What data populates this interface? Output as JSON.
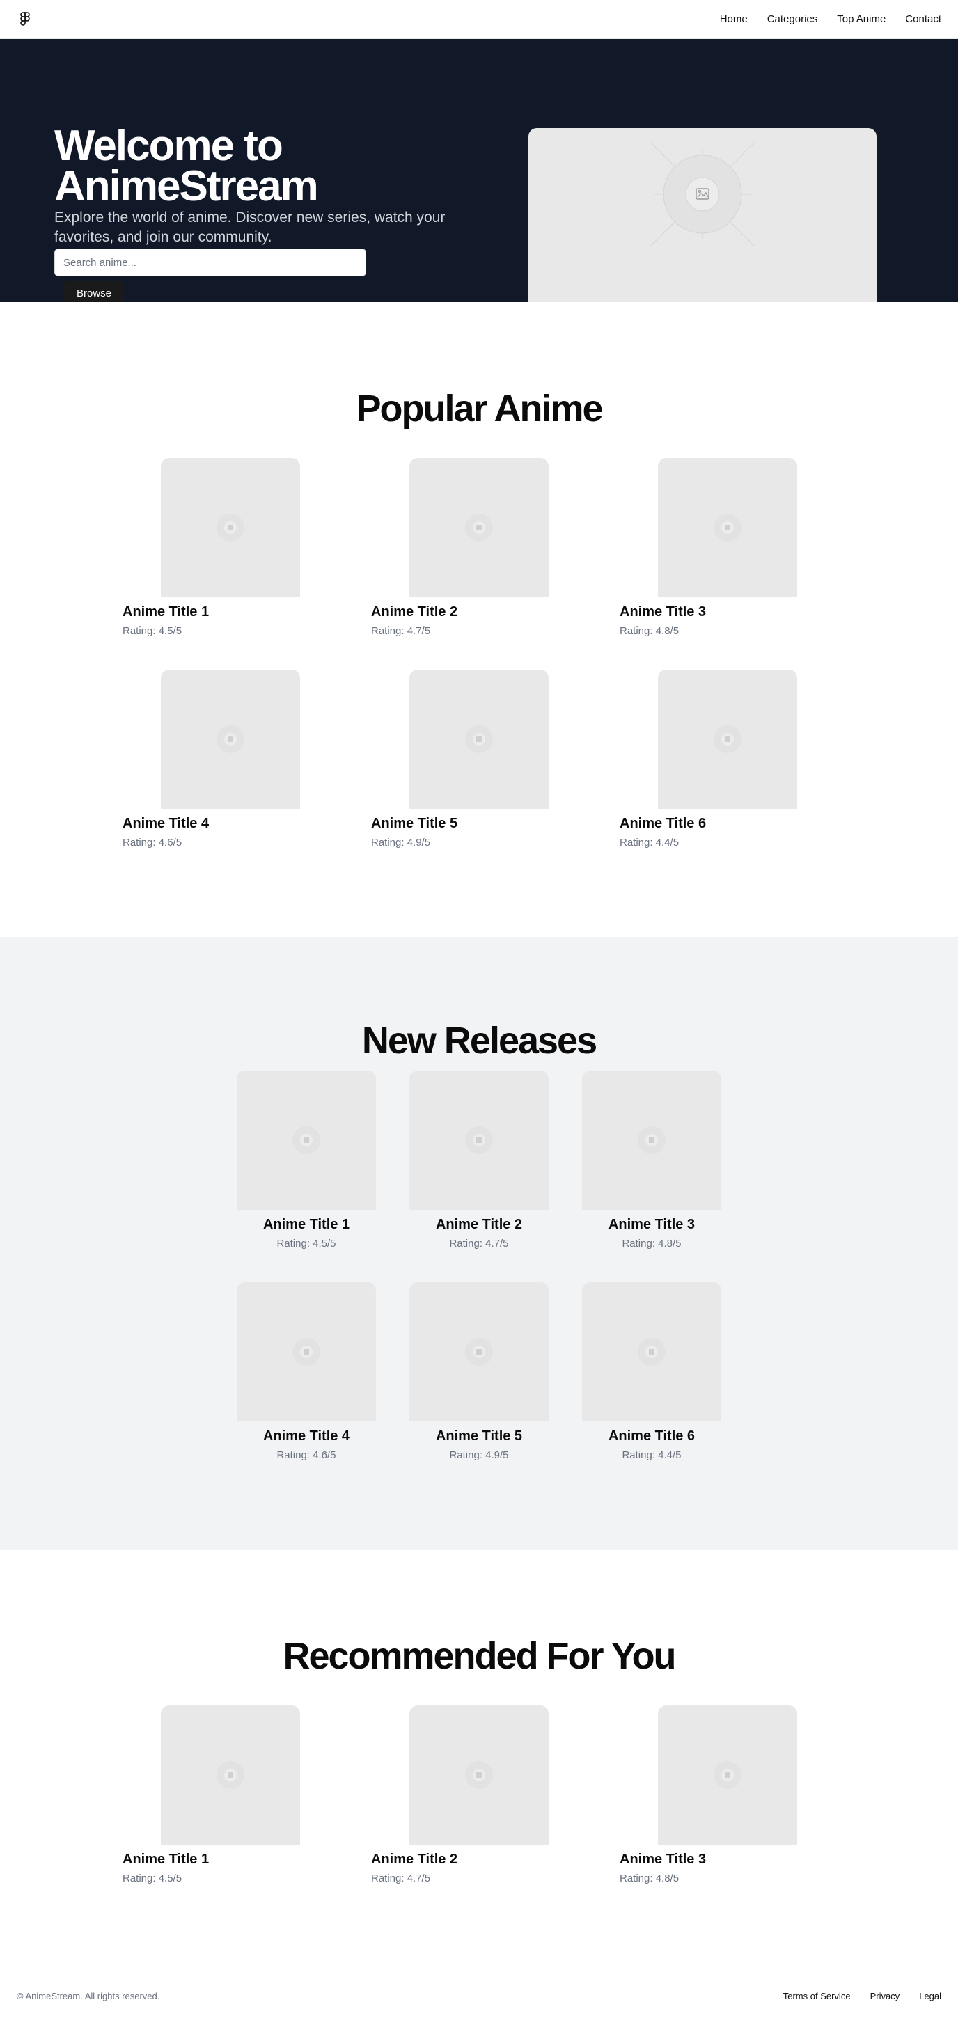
{
  "nav": {
    "logo_icon": "figma-logo-icon",
    "links": [
      {
        "label": "Home"
      },
      {
        "label": "Categories"
      },
      {
        "label": "Top Anime"
      },
      {
        "label": "Contact"
      }
    ]
  },
  "hero": {
    "title_line1": "Welcome to",
    "title_line2": "AnimeStream",
    "subtitle": "Explore the world of anime. Discover new series, watch your favorites, and join our community.",
    "search_placeholder": "Search anime...",
    "button_label": "Browse",
    "image_icon": "image-placeholder-icon"
  },
  "popular": {
    "title": "Popular Anime",
    "items": [
      {
        "title": "Anime Title 1",
        "rating": "Rating: 4.5/5"
      },
      {
        "title": "Anime Title 2",
        "rating": "Rating: 4.7/5"
      },
      {
        "title": "Anime Title 3",
        "rating": "Rating: 4.8/5"
      },
      {
        "title": "Anime Title 4",
        "rating": "Rating: 4.6/5"
      },
      {
        "title": "Anime Title 5",
        "rating": "Rating: 4.9/5"
      },
      {
        "title": "Anime Title 6",
        "rating": "Rating: 4.4/5"
      }
    ]
  },
  "new_releases": {
    "title": "New Releases",
    "items": [
      {
        "title": "Anime Title 1",
        "rating": "Rating: 4.5/5"
      },
      {
        "title": "Anime Title 2",
        "rating": "Rating: 4.7/5"
      },
      {
        "title": "Anime Title 3",
        "rating": "Rating: 4.8/5"
      },
      {
        "title": "Anime Title 4",
        "rating": "Rating: 4.6/5"
      },
      {
        "title": "Anime Title 5",
        "rating": "Rating: 4.9/5"
      },
      {
        "title": "Anime Title 6",
        "rating": "Rating: 4.4/5"
      }
    ]
  },
  "recommended": {
    "title": "Recommended For You",
    "items": [
      {
        "title": "Anime Title 1",
        "rating": "Rating: 4.5/5"
      },
      {
        "title": "Anime Title 2",
        "rating": "Rating: 4.7/5"
      },
      {
        "title": "Anime Title 3",
        "rating": "Rating: 4.8/5"
      }
    ]
  },
  "footer": {
    "copyright": "© AnimeStream. All rights reserved.",
    "links": [
      {
        "label": "Terms of Service"
      },
      {
        "label": "Privacy"
      },
      {
        "label": "Legal"
      }
    ]
  },
  "colors": {
    "hero_bg": "#111827",
    "new_releases_bg": "#f2f3f5",
    "placeholder": "#e8e8e8"
  }
}
